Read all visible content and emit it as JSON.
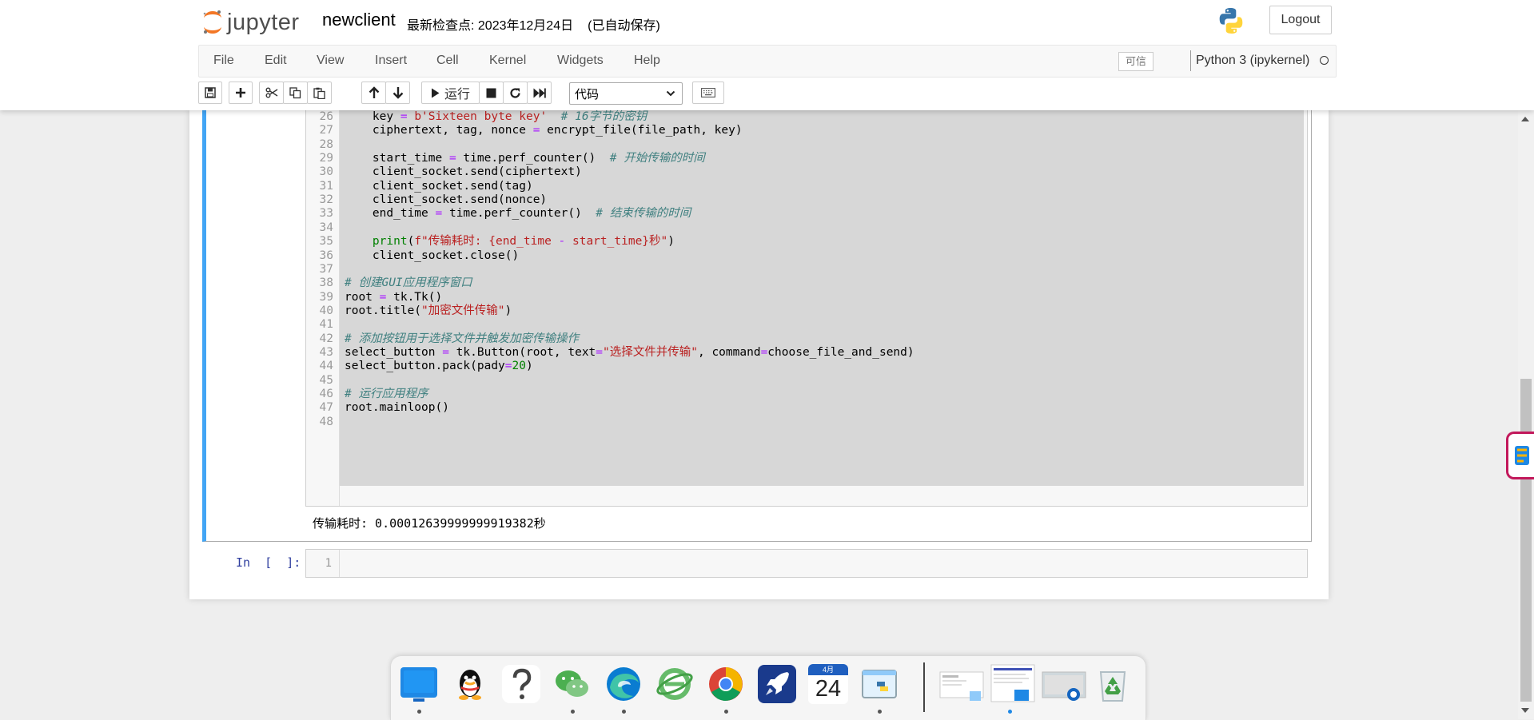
{
  "header": {
    "logo_text": "jupyter",
    "notebook_name": "newclient",
    "checkpoint_label": "最新检查点:",
    "checkpoint_date": "2023年12月24日",
    "autosave_status": "(已自动保存)",
    "logout_label": "Logout"
  },
  "menubar": {
    "items": [
      "File",
      "Edit",
      "View",
      "Insert",
      "Cell",
      "Kernel",
      "Widgets",
      "Help"
    ],
    "trusted": "可信",
    "kernel_name": "Python 3 (ipykernel)"
  },
  "toolbar": {
    "run_label": "运行",
    "cell_type": "代码",
    "icons": [
      "save-icon",
      "plus-icon",
      "cut-icon",
      "copy-icon",
      "paste-icon",
      "arrow-up-icon",
      "arrow-down-icon",
      "run-icon",
      "stop-icon",
      "restart-icon",
      "fast-forward-icon",
      "keyboard-icon"
    ]
  },
  "code_cell": {
    "lines": [
      {
        "n": "26",
        "src": "    key = b'Sixteen byte key'  # 16字节的密钥"
      },
      {
        "n": "27",
        "src": "    ciphertext, tag, nonce = encrypt_file(file_path, key)"
      },
      {
        "n": "28",
        "src": ""
      },
      {
        "n": "29",
        "src": "    start_time = time.perf_counter()  # 开始传输的时间"
      },
      {
        "n": "30",
        "src": "    client_socket.send(ciphertext)"
      },
      {
        "n": "31",
        "src": "    client_socket.send(tag)"
      },
      {
        "n": "32",
        "src": "    client_socket.send(nonce)"
      },
      {
        "n": "33",
        "src": "    end_time = time.perf_counter()  # 结束传输的时间"
      },
      {
        "n": "34",
        "src": ""
      },
      {
        "n": "35",
        "src": "    print(f\"传输耗时: {end_time - start_time}秒\")"
      },
      {
        "n": "36",
        "src": "    client_socket.close()"
      },
      {
        "n": "37",
        "src": ""
      },
      {
        "n": "38",
        "src": "# 创建GUI应用程序窗口"
      },
      {
        "n": "39",
        "src": "root = tk.Tk()"
      },
      {
        "n": "40",
        "src": "root.title(\"加密文件传输\")"
      },
      {
        "n": "41",
        "src": ""
      },
      {
        "n": "42",
        "src": "# 添加按钮用于选择文件并触发加密传输操作"
      },
      {
        "n": "43",
        "src": "select_button = tk.Button(root, text=\"选择文件并传输\", command=choose_file_and_send)"
      },
      {
        "n": "44",
        "src": "select_button.pack(pady=20)"
      },
      {
        "n": "45",
        "src": ""
      },
      {
        "n": "46",
        "src": "# 运行应用程序"
      },
      {
        "n": "47",
        "src": "root.mainloop()"
      },
      {
        "n": "48",
        "src": ""
      }
    ],
    "output": "传输耗时: 0.00012639999999919382秒"
  },
  "empty_cell": {
    "prompt": "In  [  ]:",
    "line_number": "1"
  },
  "dock": {
    "apps": [
      "desktop-icon",
      "qq-icon",
      "help-icon",
      "wechat-icon",
      "edge-icon",
      "ie-browser-icon",
      "chrome-icon",
      "rocket-icon",
      "calendar-icon",
      "python-idle-icon",
      "window-thumbnail-1",
      "window-thumbnail-2",
      "window-thumbnail-3",
      "recycle-bin-icon"
    ],
    "calendar_month": "4月",
    "calendar_day": "24"
  },
  "colors": {
    "selected_cell_border": "#42a5f5",
    "jupyter_orange": "#f37726",
    "prompt_blue": "#303f9f",
    "code_comment": "#408080",
    "code_string": "#ba2121",
    "code_keyword": "#008000"
  }
}
